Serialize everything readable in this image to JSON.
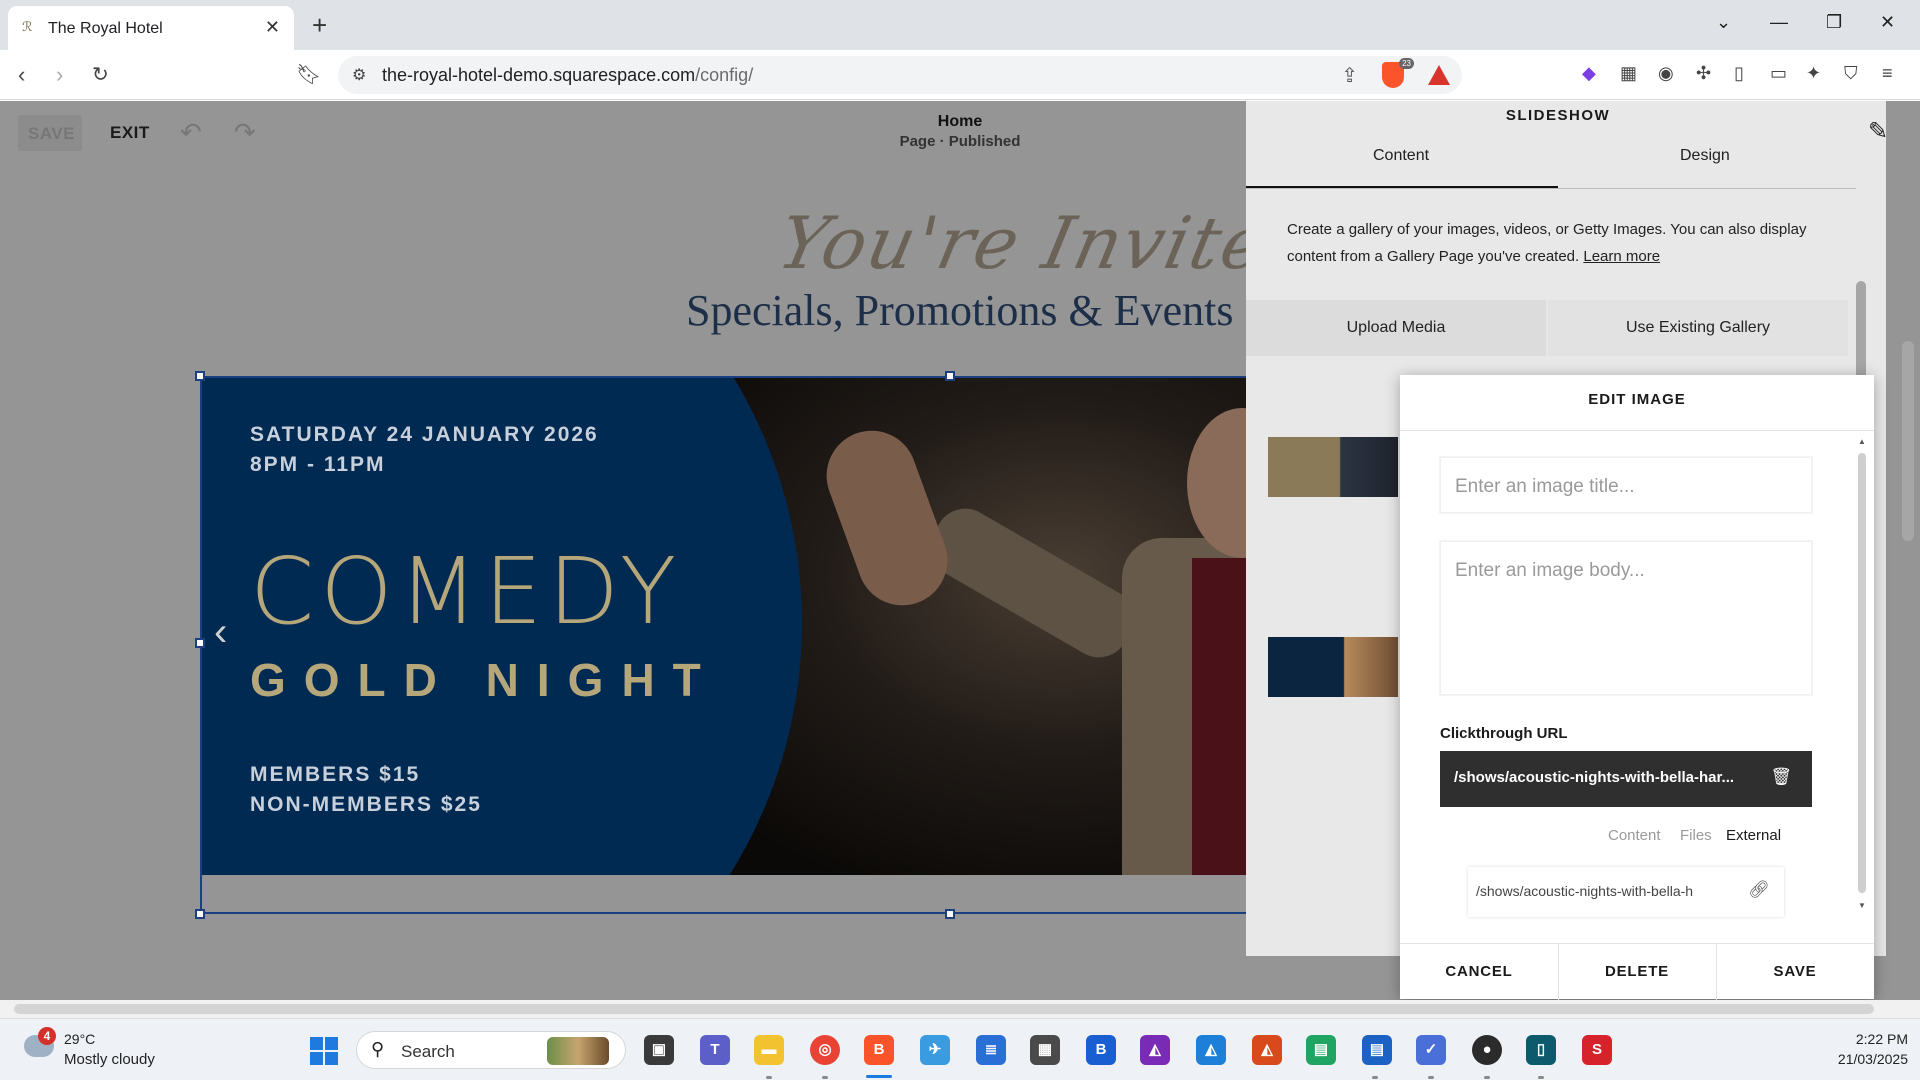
{
  "browser": {
    "tab_title": "The Royal Hotel",
    "url_domain": "the-royal-hotel-demo.squarespace.com",
    "url_path": "/config/",
    "shield_count": "23"
  },
  "editor": {
    "save_label": "SAVE",
    "exit_label": "EXIT",
    "page_title": "Home",
    "page_status": "Page · Published"
  },
  "page": {
    "script_heading": "You're Invited",
    "heading": "Specials, Promotions & Events"
  },
  "slide": {
    "date_line": "SATURDAY 24 JANUARY 2026",
    "time_line": "8PM - 11PM",
    "title_1": "COMEDY",
    "title_2": "GOLD NIGHT",
    "price_members": "MEMBERS $15",
    "price_non_members": "NON-MEMBERS $25"
  },
  "panel": {
    "title": "SLIDESHOW",
    "tabs": [
      {
        "label": "Content",
        "active": true
      },
      {
        "label": "Design",
        "active": false
      }
    ],
    "description": "Create a gallery of your images, videos, or Getty Images. You can also display content from a Gallery Page you've created.",
    "learn_more": "Learn more",
    "upload_label": "Upload Media",
    "existing_label": "Use Existing Gallery"
  },
  "modal": {
    "title": "EDIT IMAGE",
    "title_placeholder": "Enter an image title...",
    "body_placeholder": "Enter an image body...",
    "clickthrough_label": "Clickthrough URL",
    "clickthrough_value": "/shows/acoustic-nights-with-bella-har...",
    "link_options": [
      {
        "label": "Content",
        "active": false
      },
      {
        "label": "Files",
        "active": false
      },
      {
        "label": "External",
        "active": true
      }
    ],
    "external_value": "/shows/acoustic-nights-with-bella-h",
    "cancel_label": "CANCEL",
    "delete_label": "DELETE",
    "save_label": "SAVE"
  },
  "taskbar": {
    "weather_badge": "4",
    "weather_temp": "29°C",
    "weather_desc": "Mostly cloudy",
    "search_label": "Search",
    "time": "2:22 PM",
    "date": "21/03/2025"
  },
  "colors": {
    "slide_circle": "#002a52",
    "slide_gold": "#b6a77b",
    "heading": "#1d2f48",
    "selection": "#1c3f82",
    "windows_accent": "#1f7ae0"
  }
}
